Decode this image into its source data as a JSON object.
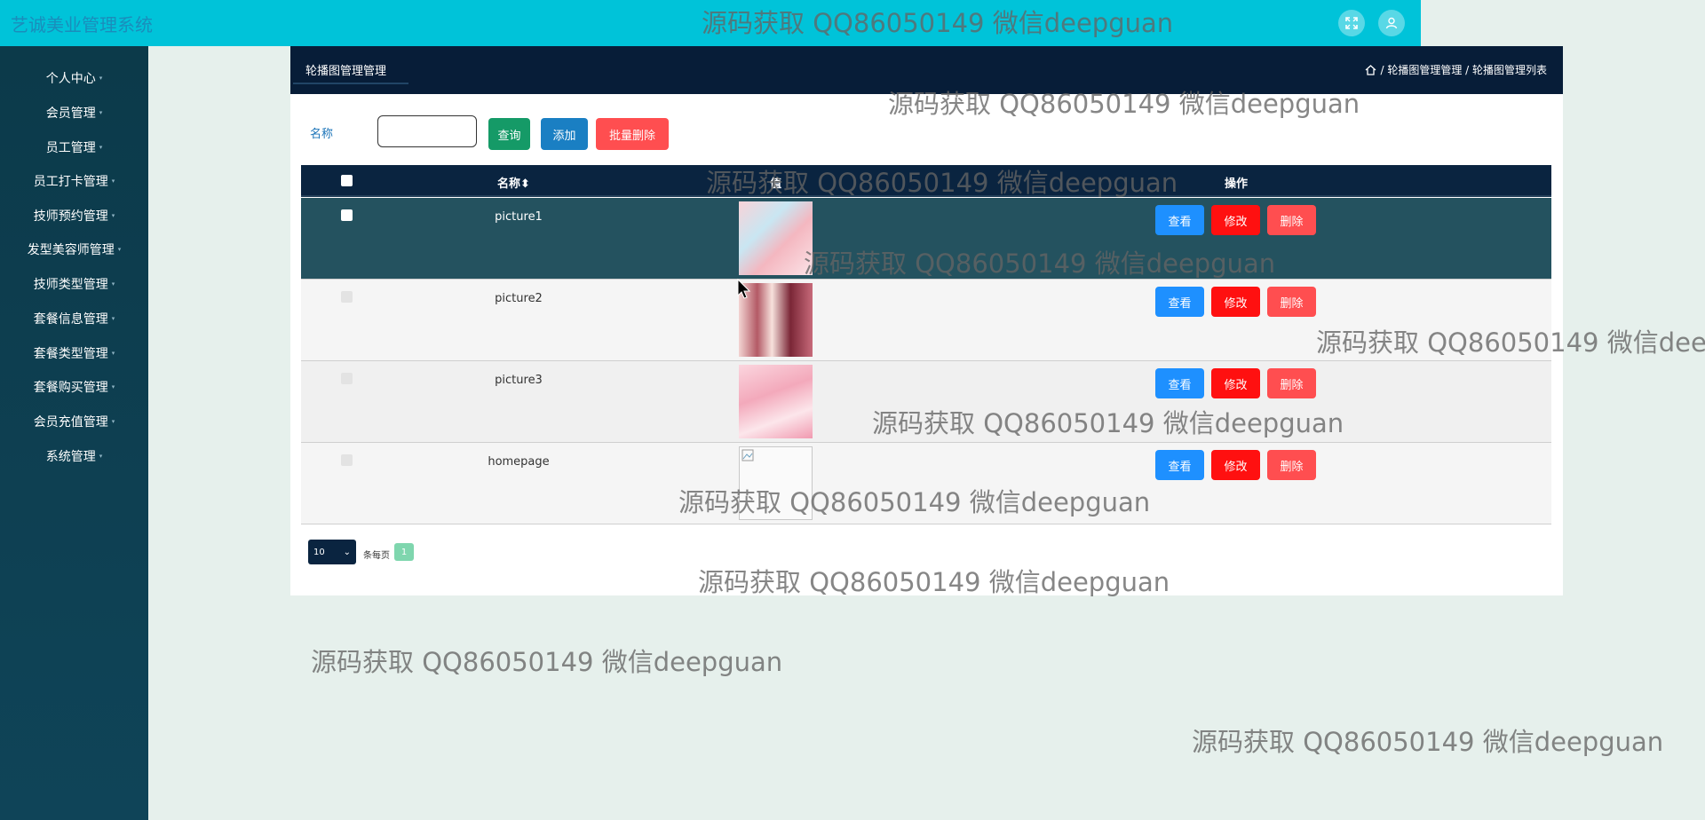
{
  "header": {
    "title": "艺诚美业管理系统",
    "fullscreen_icon": "expand-icon",
    "user_icon": "user-icon"
  },
  "sidebar": {
    "items": [
      {
        "label": "个人中心"
      },
      {
        "label": "会员管理"
      },
      {
        "label": "员工管理"
      },
      {
        "label": "员工打卡管理"
      },
      {
        "label": "技师预约管理"
      },
      {
        "label": "发型美容师管理"
      },
      {
        "label": "技师类型管理"
      },
      {
        "label": "套餐信息管理"
      },
      {
        "label": "套餐类型管理"
      },
      {
        "label": "套餐购买管理"
      },
      {
        "label": "会员充值管理"
      },
      {
        "label": "系统管理"
      }
    ]
  },
  "panel": {
    "tab": "轮播图管理管理",
    "breadcrumb": "/ 轮播图管理管理 / 轮播图管理列表",
    "home_icon": "home-icon"
  },
  "search": {
    "label": "名称",
    "value": "",
    "query_btn": "查询",
    "add_btn": "添加",
    "batch_delete_btn": "批量删除"
  },
  "table": {
    "headers": {
      "name": "名称",
      "value": "值",
      "actions": "操作"
    },
    "rows": [
      {
        "name": "picture1",
        "image": "pink-floral-banner"
      },
      {
        "name": "picture2",
        "image": "cosmetics-banner"
      },
      {
        "name": "picture3",
        "image": "pink-promo-banner"
      },
      {
        "name": "homepage",
        "image": "broken-image"
      }
    ],
    "actions": {
      "view": "查看",
      "edit": "修改",
      "delete": "删除"
    }
  },
  "pagination": {
    "page_size": "10",
    "per_page_text": "条每页",
    "current_page": "1"
  },
  "watermark": "源码获取 QQ86050149 微信deepguan",
  "colors": {
    "header_bg": "#00c3d9",
    "sidebar_bg": "#0c3a4a",
    "panel_head": "#071d38",
    "view_btn": "#1e90ff",
    "edit_btn": "#ff1010",
    "delete_btn": "#ff4e50",
    "query_btn": "#159a67",
    "add_btn": "#1a7fc3"
  }
}
